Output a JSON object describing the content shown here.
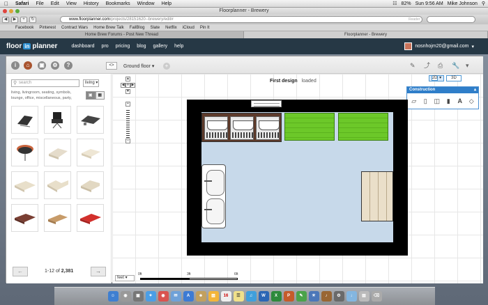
{
  "mac": {
    "menu": [
      "Safari",
      "File",
      "Edit",
      "View",
      "History",
      "Bookmarks",
      "Window",
      "Help"
    ],
    "clock": "Sun 9:56 AM",
    "user": "Mike Johnson",
    "battery": "82%"
  },
  "browser": {
    "window_title": "Floorplanner - Brewery",
    "url_host": "www.floorplanner.com",
    "url_path": "/projects/28151620--brewery/edit#",
    "reader": "Reader",
    "bookmarks": [
      "Facebook",
      "Pinterest",
      "Contract Wars",
      "Home Brew Talk",
      "FailBlog",
      "Slate",
      "Netflix",
      "iCloud",
      "Pin It"
    ],
    "tabs": [
      "Home Brew Forums - Post New Thread",
      "Floorplanner - Brewery"
    ]
  },
  "fp": {
    "logo_left": "floor",
    "logo_mid": "in",
    "logo_right": "planner",
    "nav": [
      "dashboard",
      "pro",
      "pricing",
      "blog",
      "gallery",
      "help"
    ],
    "user_email": "nosnhojm20@gmail.com",
    "floor_name": "Ground floor",
    "design_title": "First design",
    "design_status": "loaded",
    "search_placeholder": "search",
    "category": "living",
    "tags": "living, livingroom, seating, symbols, lounge, office, miscellaneous, party,",
    "pager_range": "1-12",
    "pager_of": "of",
    "pager_total": "2,381",
    "mode_2d": "2D",
    "mode_3d": "3D",
    "construction_title": "Construction",
    "unit": "feet",
    "scale_labels": [
      "0ft",
      "3ft",
      "6ft"
    ]
  },
  "colors": {
    "accent": "#2f7ec9",
    "nav_bg": "#263845",
    "green": "#6cc829"
  }
}
